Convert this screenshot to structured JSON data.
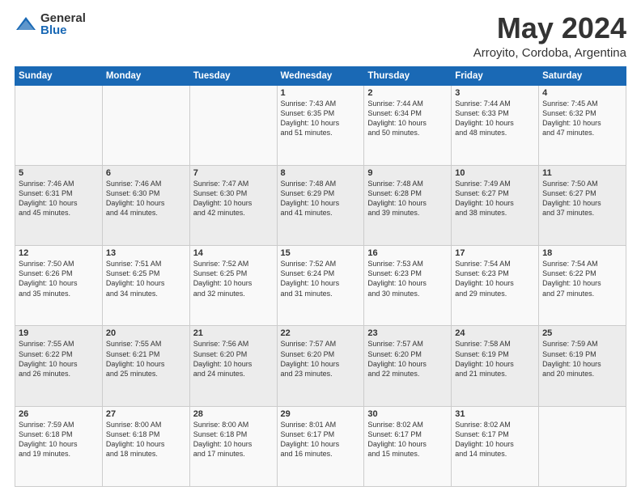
{
  "header": {
    "logo_general": "General",
    "logo_blue": "Blue",
    "month": "May 2024",
    "location": "Arroyito, Cordoba, Argentina"
  },
  "days_of_week": [
    "Sunday",
    "Monday",
    "Tuesday",
    "Wednesday",
    "Thursday",
    "Friday",
    "Saturday"
  ],
  "weeks": [
    [
      {
        "day": "",
        "info": ""
      },
      {
        "day": "",
        "info": ""
      },
      {
        "day": "",
        "info": ""
      },
      {
        "day": "1",
        "info": "Sunrise: 7:43 AM\nSunset: 6:35 PM\nDaylight: 10 hours\nand 51 minutes."
      },
      {
        "day": "2",
        "info": "Sunrise: 7:44 AM\nSunset: 6:34 PM\nDaylight: 10 hours\nand 50 minutes."
      },
      {
        "day": "3",
        "info": "Sunrise: 7:44 AM\nSunset: 6:33 PM\nDaylight: 10 hours\nand 48 minutes."
      },
      {
        "day": "4",
        "info": "Sunrise: 7:45 AM\nSunset: 6:32 PM\nDaylight: 10 hours\nand 47 minutes."
      }
    ],
    [
      {
        "day": "5",
        "info": "Sunrise: 7:46 AM\nSunset: 6:31 PM\nDaylight: 10 hours\nand 45 minutes."
      },
      {
        "day": "6",
        "info": "Sunrise: 7:46 AM\nSunset: 6:30 PM\nDaylight: 10 hours\nand 44 minutes."
      },
      {
        "day": "7",
        "info": "Sunrise: 7:47 AM\nSunset: 6:30 PM\nDaylight: 10 hours\nand 42 minutes."
      },
      {
        "day": "8",
        "info": "Sunrise: 7:48 AM\nSunset: 6:29 PM\nDaylight: 10 hours\nand 41 minutes."
      },
      {
        "day": "9",
        "info": "Sunrise: 7:48 AM\nSunset: 6:28 PM\nDaylight: 10 hours\nand 39 minutes."
      },
      {
        "day": "10",
        "info": "Sunrise: 7:49 AM\nSunset: 6:27 PM\nDaylight: 10 hours\nand 38 minutes."
      },
      {
        "day": "11",
        "info": "Sunrise: 7:50 AM\nSunset: 6:27 PM\nDaylight: 10 hours\nand 37 minutes."
      }
    ],
    [
      {
        "day": "12",
        "info": "Sunrise: 7:50 AM\nSunset: 6:26 PM\nDaylight: 10 hours\nand 35 minutes."
      },
      {
        "day": "13",
        "info": "Sunrise: 7:51 AM\nSunset: 6:25 PM\nDaylight: 10 hours\nand 34 minutes."
      },
      {
        "day": "14",
        "info": "Sunrise: 7:52 AM\nSunset: 6:25 PM\nDaylight: 10 hours\nand 32 minutes."
      },
      {
        "day": "15",
        "info": "Sunrise: 7:52 AM\nSunset: 6:24 PM\nDaylight: 10 hours\nand 31 minutes."
      },
      {
        "day": "16",
        "info": "Sunrise: 7:53 AM\nSunset: 6:23 PM\nDaylight: 10 hours\nand 30 minutes."
      },
      {
        "day": "17",
        "info": "Sunrise: 7:54 AM\nSunset: 6:23 PM\nDaylight: 10 hours\nand 29 minutes."
      },
      {
        "day": "18",
        "info": "Sunrise: 7:54 AM\nSunset: 6:22 PM\nDaylight: 10 hours\nand 27 minutes."
      }
    ],
    [
      {
        "day": "19",
        "info": "Sunrise: 7:55 AM\nSunset: 6:22 PM\nDaylight: 10 hours\nand 26 minutes."
      },
      {
        "day": "20",
        "info": "Sunrise: 7:55 AM\nSunset: 6:21 PM\nDaylight: 10 hours\nand 25 minutes."
      },
      {
        "day": "21",
        "info": "Sunrise: 7:56 AM\nSunset: 6:20 PM\nDaylight: 10 hours\nand 24 minutes."
      },
      {
        "day": "22",
        "info": "Sunrise: 7:57 AM\nSunset: 6:20 PM\nDaylight: 10 hours\nand 23 minutes."
      },
      {
        "day": "23",
        "info": "Sunrise: 7:57 AM\nSunset: 6:20 PM\nDaylight: 10 hours\nand 22 minutes."
      },
      {
        "day": "24",
        "info": "Sunrise: 7:58 AM\nSunset: 6:19 PM\nDaylight: 10 hours\nand 21 minutes."
      },
      {
        "day": "25",
        "info": "Sunrise: 7:59 AM\nSunset: 6:19 PM\nDaylight: 10 hours\nand 20 minutes."
      }
    ],
    [
      {
        "day": "26",
        "info": "Sunrise: 7:59 AM\nSunset: 6:18 PM\nDaylight: 10 hours\nand 19 minutes."
      },
      {
        "day": "27",
        "info": "Sunrise: 8:00 AM\nSunset: 6:18 PM\nDaylight: 10 hours\nand 18 minutes."
      },
      {
        "day": "28",
        "info": "Sunrise: 8:00 AM\nSunset: 6:18 PM\nDaylight: 10 hours\nand 17 minutes."
      },
      {
        "day": "29",
        "info": "Sunrise: 8:01 AM\nSunset: 6:17 PM\nDaylight: 10 hours\nand 16 minutes."
      },
      {
        "day": "30",
        "info": "Sunrise: 8:02 AM\nSunset: 6:17 PM\nDaylight: 10 hours\nand 15 minutes."
      },
      {
        "day": "31",
        "info": "Sunrise: 8:02 AM\nSunset: 6:17 PM\nDaylight: 10 hours\nand 14 minutes."
      },
      {
        "day": "",
        "info": ""
      }
    ]
  ]
}
